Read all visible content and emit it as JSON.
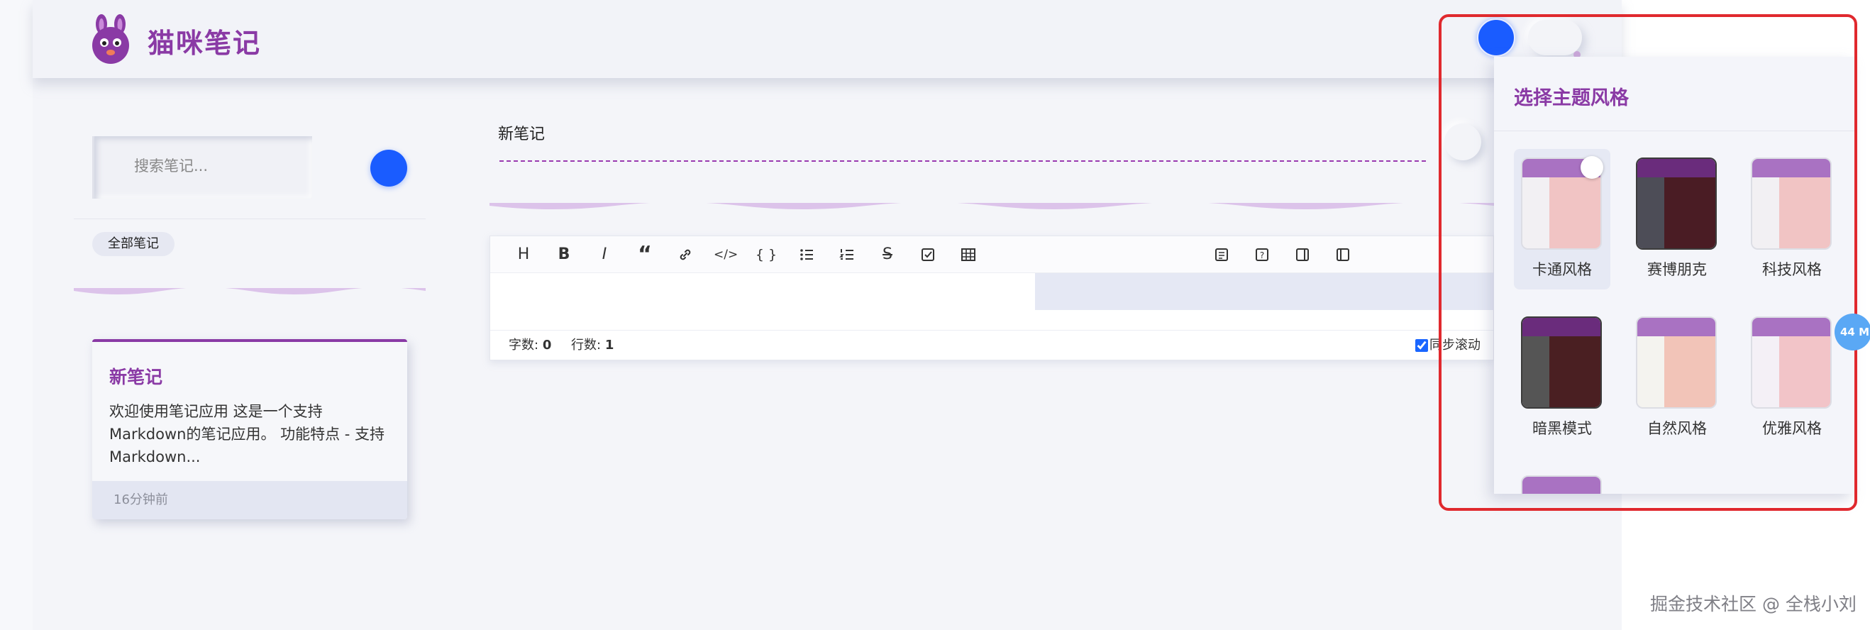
{
  "app": {
    "title": "猫咪笔记",
    "logo_icon": "bunny-logo-icon",
    "brand_color": "#8a3aa5",
    "accent_color": "#1a5cff"
  },
  "sidebar": {
    "search_placeholder": "搜索笔记...",
    "filter_chip": "全部笔记",
    "notes": [
      {
        "title": "新笔记",
        "excerpt": "欢迎使用笔记应用 这是一个支持Markdown的笔记应用。 功能特点 - 支持Markdown...",
        "time": "16分钟前"
      }
    ]
  },
  "editor": {
    "title_value": "新笔记",
    "toolbar": [
      {
        "icon": "heading-icon",
        "glyph": "H"
      },
      {
        "icon": "bold-icon",
        "glyph": "B"
      },
      {
        "icon": "italic-icon",
        "glyph": "I"
      },
      {
        "icon": "quote-icon",
        "glyph": "“"
      },
      {
        "icon": "link-icon",
        "glyph": ""
      },
      {
        "icon": "inline-code-icon",
        "glyph": "</>"
      },
      {
        "icon": "code-block-icon",
        "glyph": "{ }"
      },
      {
        "icon": "bullet-list-icon",
        "glyph": ""
      },
      {
        "icon": "ordered-list-icon",
        "glyph": ""
      },
      {
        "icon": "strikethrough-icon",
        "glyph": "S"
      },
      {
        "icon": "task-list-icon",
        "glyph": ""
      },
      {
        "icon": "table-icon",
        "glyph": ""
      }
    ],
    "toolbar_right": [
      {
        "icon": "preview-mode-icon"
      },
      {
        "icon": "help-icon"
      },
      {
        "icon": "split-right-icon"
      },
      {
        "icon": "split-left-icon"
      }
    ],
    "status": {
      "words_label": "字数:",
      "words_value": "0",
      "lines_label": "行数:",
      "lines_value": "1",
      "sync_scroll_label": "同步滚动",
      "sync_scroll_checked": true
    }
  },
  "theme_popup": {
    "title": "选择主题风格",
    "selected": "卡通风格",
    "themes": [
      {
        "name": "卡通风格",
        "top": "#a972c2",
        "left": "#f2f0f3",
        "right": "#f1c4c4",
        "dark": false
      },
      {
        "name": "赛博朋克",
        "top": "#6a2c7c",
        "left": "#4d4d57",
        "right": "#4a1c24",
        "dark": true
      },
      {
        "name": "科技风格",
        "top": "#a972c2",
        "left": "#f2f0f3",
        "right": "#f1c4c4",
        "dark": false
      },
      {
        "name": "暗黑模式",
        "top": "#6a2c7c",
        "left": "#555555",
        "right": "#4a1f22",
        "dark": true
      },
      {
        "name": "自然风格",
        "top": "#a972c2",
        "left": "#f4f3ef",
        "right": "#f2c4b8",
        "dark": false
      },
      {
        "name": "优雅风格",
        "top": "#a972c2",
        "left": "#f4f0f6",
        "right": "#f2c4c8",
        "dark": false
      },
      {
        "name": "",
        "top": "#a972c2",
        "left": "#f2f0f3",
        "right": "#f1c4c4",
        "dark": false
      }
    ]
  },
  "overlay": {
    "memory_badge": "44 M",
    "watermark": "掘金技术社区 @ 全栈小刘",
    "annotation_frame_color": "#e0292e"
  }
}
